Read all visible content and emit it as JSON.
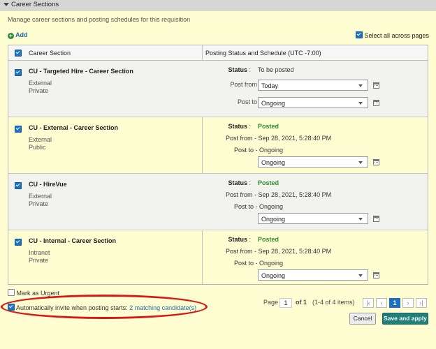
{
  "panel": {
    "title": "Career Sections",
    "subtitle": "Manage career sections and posting schedules for this requisition"
  },
  "toolbar": {
    "add_label": "Add",
    "select_all_label": "Select all across pages"
  },
  "table": {
    "col_section": "Career Section",
    "col_posting": "Posting Status and Schedule (UTC -7:00)",
    "rows": [
      {
        "name": "CU - Targeted Hire - Career Section",
        "type": "External",
        "visibility": "Private",
        "status_label": "Status",
        "status": "To be posted",
        "post_from_label": "Post from",
        "post_from_value": "Today",
        "post_to_label": "Post to",
        "post_to_value": "Ongoing"
      },
      {
        "name": "CU - External - Career Section",
        "type": "External",
        "visibility": "Public",
        "status_label": "Status",
        "status": "Posted",
        "post_from_text": "Post from - Sep 28, 2021, 5:28:40 PM",
        "post_to_text": "Post to - Ongoing",
        "post_to_value": "Ongoing"
      },
      {
        "name": "CU - HireVue",
        "type": "External",
        "visibility": "Private",
        "status_label": "Status",
        "status": "Posted",
        "post_from_text": "Post from - Sep 28, 2021, 5:28:40 PM",
        "post_to_text": "Post to - Ongoing",
        "post_to_value": "Ongoing"
      },
      {
        "name": "CU - Internal - Career Section",
        "type": "Intranet",
        "visibility": "Private",
        "status_label": "Status",
        "status": "Posted",
        "post_from_text": "Post from - Sep 28, 2021, 5:28:40 PM",
        "post_to_text": "Post to - Ongoing",
        "post_to_value": "Ongoing"
      }
    ]
  },
  "options": {
    "urgent_label": "Mark as Urgent",
    "auto_invite_label": "Automatically invite when posting starts:",
    "auto_invite_link": "2 matching candidate(s)"
  },
  "pager": {
    "page_label": "Page",
    "page_value": "1",
    "of_label": "of 1",
    "range": "(1-4 of 4 items)",
    "current": "1"
  },
  "buttons": {
    "cancel": "Cancel",
    "save": "Save and apply"
  },
  "colors": {
    "background": "#fefed2",
    "accent": "#1c74c6",
    "posted": "#2e8b2e",
    "highlight_oval": "#d91818",
    "save_button": "#1f7f7a"
  }
}
